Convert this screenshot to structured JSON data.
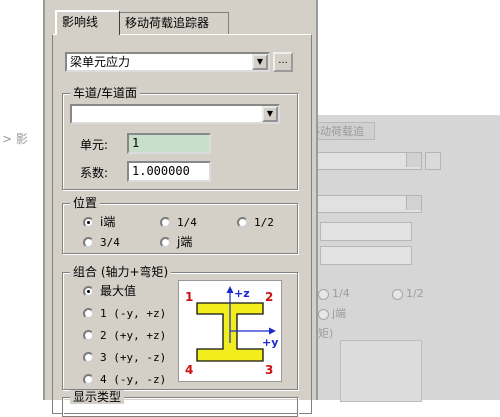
{
  "background_window": {
    "tab_label": "移动荷载追踪器",
    "position_options": [
      "1/4",
      "1/2",
      "j端"
    ],
    "group_label": "矩)",
    "left_text": "> 影"
  },
  "window": {
    "tabs": [
      {
        "label": "影响线",
        "active": true
      },
      {
        "label": "移动荷载追踪器",
        "active": false
      }
    ],
    "result_type": {
      "value": "梁单元应力",
      "more_label": "..."
    },
    "lane_group": {
      "title": "车道/车道面",
      "lane_value": ""
    },
    "element": {
      "label": "单元:",
      "value": "1"
    },
    "factor": {
      "label": "系数:",
      "value": "1.000000"
    },
    "position_group": {
      "title": "位置",
      "options": [
        {
          "label": "i端",
          "checked": true
        },
        {
          "label": "1/4",
          "checked": false
        },
        {
          "label": "1/2",
          "checked": false
        },
        {
          "label": "3/4",
          "checked": false
        },
        {
          "label": "j端",
          "checked": false
        }
      ]
    },
    "combination_group": {
      "title": "组合 (轴力+弯矩)",
      "options": [
        {
          "label": "最大值",
          "checked": true
        },
        {
          "label": "1 (-y, +z)",
          "checked": false
        },
        {
          "label": "2 (+y, +z)",
          "checked": false
        },
        {
          "label": "3 (+y, -z)",
          "checked": false
        },
        {
          "label": "4 (-y, -z)",
          "checked": false
        }
      ]
    },
    "section_diagram": {
      "corner_labels": [
        "1",
        "2",
        "3",
        "4"
      ],
      "axis_z_label": "+z",
      "axis_y_label": "+y",
      "fill_color": "#f2ee1e",
      "corner_color": "#cc1111",
      "axis_color": "#1a2ad0"
    },
    "display_type_group": {
      "title": "显示类型"
    }
  },
  "colors": {
    "window_face": "#d4d0c8",
    "readonly_field": "#c7dfc8"
  }
}
